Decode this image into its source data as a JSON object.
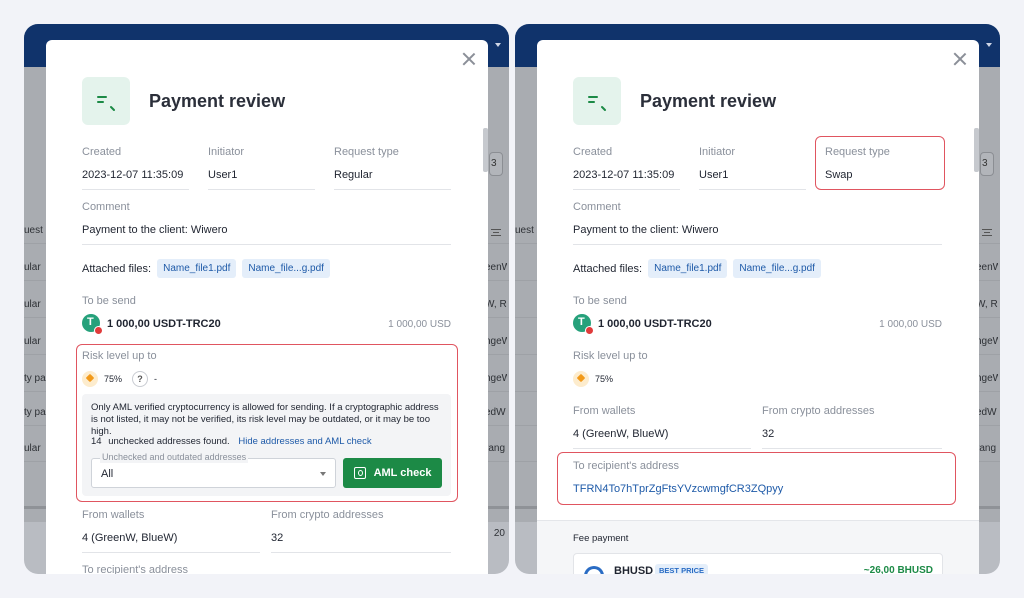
{
  "modal": {
    "title": "Payment review",
    "created_label": "Created",
    "created_value": "2023-12-07 11:35:09",
    "initiator_label": "Initiator",
    "initiator_value": "User1",
    "request_type_label": "Request type",
    "comment_label": "Comment",
    "comment_value": "Payment to the client: Wiwero",
    "attached_label": "Attached files:",
    "files": [
      "Name_file1.pdf",
      "Name_file...g.pdf"
    ],
    "to_be_send_label": "To be send",
    "amount": "1 000,00 USDT-TRC20",
    "amount_usd": "1 000,00 USD",
    "risk_label": "Risk level up to",
    "risk_percent": "75%",
    "risk_unknown_value": "-",
    "from_wallets_label": "From wallets",
    "from_wallets_value": "4 (GreenW, BlueW)",
    "from_crypto_label": "From crypto addresses",
    "from_crypto_value": "32",
    "recipient_label": "To recipient's address"
  },
  "left": {
    "request_type_value": "Regular",
    "aml_notice": "Only AML verified cryptocurrency is allowed for sending. If a cryptographic address is not listed, it may not be verified, its risk level may be outdated, or it may be too high.",
    "unchecked_count": "14",
    "unchecked_text": "unchecked addresses found.",
    "hide_link": "Hide addresses and AML check",
    "select_legend": "Unchecked and outdated addresses",
    "select_value": "All",
    "aml_button": "AML check"
  },
  "right": {
    "request_type_value": "Swap",
    "recipient_address": "TFRN4To7hTprZgFtsYVzcwmgfCR3ZQpyy",
    "fee_title": "Fee payment",
    "fee_coin": "BHUSD",
    "fee_badge": "BEST PRICE",
    "fee_price": "~26,00 BHUSD"
  },
  "background": {
    "col_header": "uest",
    "rows_left": [
      "ular",
      "ular",
      "ular",
      "ty pa",
      "ty pa",
      "ular"
    ],
    "rows_right_suffix": [
      "eenW",
      "W, R",
      "ngeW",
      "ngeW",
      "edW",
      "rang"
    ],
    "partial_box": "3",
    "partial_bottom": "20"
  },
  "colors": {
    "header_navy": "#10336b",
    "accent_green": "#1c8a46",
    "link_blue": "#1e5aa8",
    "highlight_red": "#e05560"
  }
}
